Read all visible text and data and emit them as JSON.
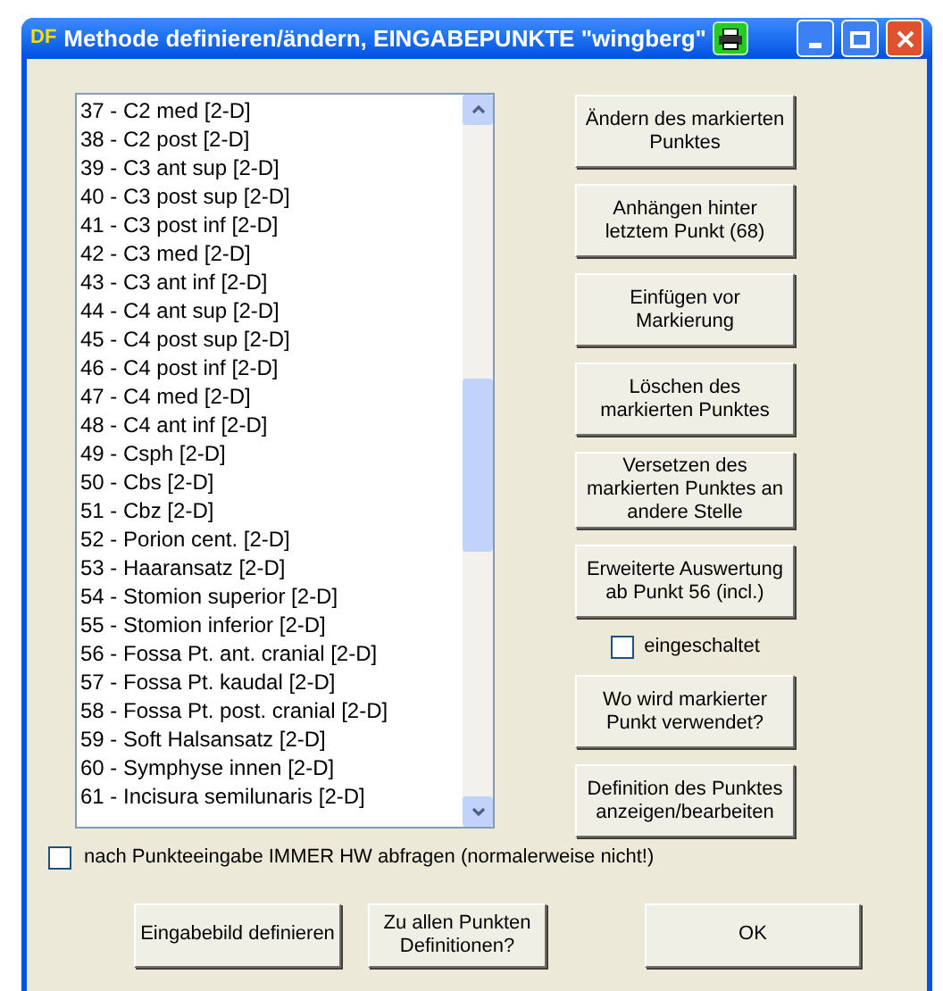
{
  "window": {
    "title": "Methode definieren/ändern, EINGABEPUNKTE \"wingberg\"",
    "logo": "DF"
  },
  "points": [
    {
      "label": "37 - C2 med [2-D]",
      "selected": false
    },
    {
      "label": "38 - C2 post [2-D]",
      "selected": false
    },
    {
      "label": "39 - C3 ant sup [2-D]",
      "selected": false
    },
    {
      "label": "40 - C3 post sup [2-D]",
      "selected": false
    },
    {
      "label": "41 - C3 post inf [2-D]",
      "selected": false
    },
    {
      "label": "42 - C3 med [2-D]",
      "selected": false
    },
    {
      "label": "43 - C3 ant inf [2-D]",
      "selected": false
    },
    {
      "label": "44 - C4 ant sup [2-D]",
      "selected": false
    },
    {
      "label": "45 - C4 post sup [2-D]",
      "selected": false
    },
    {
      "label": "46 - C4 post inf [2-D]",
      "selected": false
    },
    {
      "label": "47 - C4 med [2-D]",
      "selected": false
    },
    {
      "label": "48 - C4 ant inf [2-D]",
      "selected": false
    },
    {
      "label": "49 - Csph [2-D]",
      "selected": false
    },
    {
      "label": "50 - Cbs [2-D]",
      "selected": false
    },
    {
      "label": "51 - Cbz [2-D]",
      "selected": false
    },
    {
      "label": "52 - Porion cent. [2-D]",
      "selected": false
    },
    {
      "label": "53 - Haaransatz [2-D]",
      "selected": false
    },
    {
      "label": "54 - Stomion superior [2-D]",
      "selected": false
    },
    {
      "label": "55 - Stomion inferior [2-D]",
      "selected": false
    },
    {
      "label": "56 - Fossa Pt. ant. cranial [2-D]",
      "selected": false
    },
    {
      "label": "57 - Fossa Pt. kaudal [2-D]",
      "selected": false
    },
    {
      "label": "58 - Fossa Pt. post. cranial [2-D]",
      "selected": false
    },
    {
      "label": "59 - Soft Halsansatz [2-D]",
      "selected": false
    },
    {
      "label": "60 - Symphyse innen [2-D]",
      "selected": false
    },
    {
      "label": "61 - Incisura semilunaris [2-D]",
      "selected": false
    }
  ],
  "side_buttons": [
    {
      "kind": "button",
      "label": "Ändern des markierten Punktes"
    },
    {
      "kind": "button",
      "label": "Anhängen hinter letztem Punkt (68)"
    },
    {
      "kind": "button",
      "label": "Einfügen vor Markierung"
    },
    {
      "kind": "button",
      "label": "Löschen des markierten Punktes"
    },
    {
      "kind": "button",
      "label": "Versetzen des markierten Punktes an andere Stelle"
    },
    {
      "kind": "button",
      "label": "Erweiterte Auswertung ab Punkt 56 (incl.)"
    },
    {
      "kind": "checkbox",
      "label": "eingeschaltet",
      "checked": false
    },
    {
      "kind": "button",
      "label": "Wo wird markierter Punkt verwendet?"
    },
    {
      "kind": "button",
      "label": "Definition des Punktes anzeigen/bearbeiten"
    }
  ],
  "hw_option": {
    "label": "nach Punkteeingabe IMMER HW abfragen (normalerweise nicht!)",
    "checked": false
  },
  "bottom_buttons": [
    "Eingabebild definieren",
    "Zu allen Punkten Definitionen?",
    "OK"
  ]
}
